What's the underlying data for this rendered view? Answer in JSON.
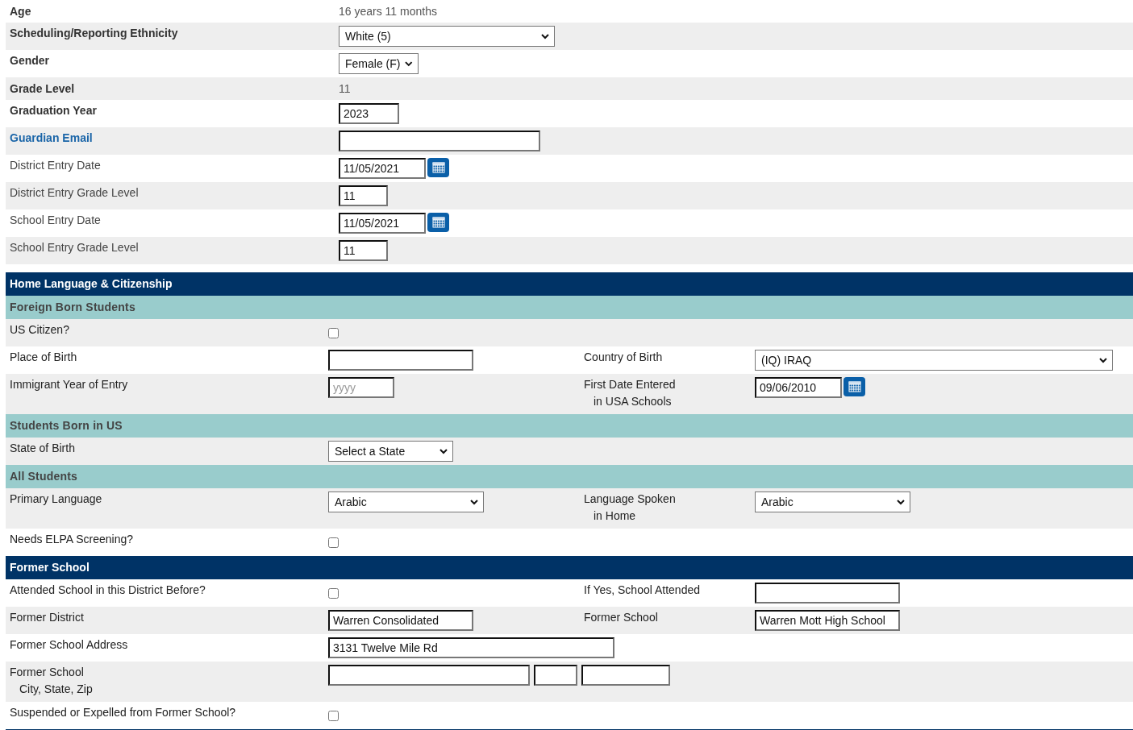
{
  "details": [
    {
      "label": "Age",
      "control": {
        "kind": "text",
        "value": "16 years 11 months"
      }
    },
    {
      "label": "Scheduling/Reporting Ethnicity",
      "control": {
        "kind": "select",
        "value": "White (5)"
      }
    },
    {
      "label": "Gender",
      "control": {
        "kind": "select",
        "value": "Female (F)"
      }
    },
    {
      "label": "Grade Level",
      "control": {
        "kind": "text",
        "value": "11"
      }
    },
    {
      "label": "Graduation Year",
      "control": {
        "kind": "input",
        "value": "2023"
      }
    },
    {
      "label": "Guardian Email",
      "control": {
        "kind": "input"
      }
    },
    {
      "label": "District Entry Date",
      "control": {
        "kind": "date",
        "value": "11/05/2021"
      }
    },
    {
      "label": "District Entry Grade Level",
      "control": {
        "kind": "input",
        "value": "11"
      }
    },
    {
      "label": "School Entry Date",
      "control": {
        "kind": "date",
        "value": "11/05/2021"
      }
    },
    {
      "label": "School Entry Grade Level",
      "control": {
        "kind": "input",
        "value": "11"
      }
    }
  ],
  "sections": [
    {
      "title": "Home Language & Citizenship",
      "groups": [
        {
          "title": "Foreign Born Students",
          "rows": [
            {
              "shaded": true,
              "label": [
                "US Citizen?"
              ],
              "control": {
                "kind": "checkbox",
                "checked": false
              }
            },
            {
              "shaded": false,
              "label": [
                "Place of Birth"
              ],
              "control": {
                "kind": "input"
              },
              "label_2": [
                "Country of Birth"
              ],
              "control_2": {
                "kind": "select",
                "value": "(IQ) IRAQ"
              }
            },
            {
              "shaded": true,
              "label": [
                "Immigrant Year of Entry"
              ],
              "control": {
                "kind": "input",
                "placeholder": "yyyy"
              },
              "label_2": [
                "First Date Entered",
                "in USA Schools"
              ],
              "control_2": {
                "kind": "date",
                "value": "09/06/2010"
              }
            }
          ]
        },
        {
          "title": "Students Born in US",
          "rows": [
            {
              "shaded": true,
              "label": [
                "State of Birth"
              ],
              "control": {
                "kind": "select",
                "value": "Select a State"
              }
            }
          ]
        },
        {
          "title": "All Students",
          "rows": [
            {
              "shaded": true,
              "label": [
                "Primary Language"
              ],
              "control": {
                "kind": "select",
                "value": "Arabic"
              },
              "label_2": [
                "Language Spoken",
                "in Home"
              ],
              "control_2": {
                "kind": "select",
                "value": "Arabic"
              }
            },
            {
              "shaded": false,
              "label": [
                "Needs ELPA Screening?"
              ],
              "control": {
                "kind": "checkbox",
                "checked": false
              }
            }
          ]
        }
      ]
    },
    {
      "title": "Former School",
      "groups": [
        {
          "rows": [
            {
              "shaded": false,
              "label": [
                "Attended School in this District Before?"
              ],
              "control": {
                "kind": "checkbox",
                "checked": false
              },
              "label_2": [
                "If Yes, School Attended"
              ],
              "control_2": {
                "kind": "input"
              }
            },
            {
              "shaded": true,
              "label": [
                "Former District"
              ],
              "control": {
                "kind": "input",
                "value": "Warren Consolidated"
              },
              "label_2": [
                "Former School"
              ],
              "control_2": {
                "kind": "input",
                "value": "Warren Mott High School"
              }
            },
            {
              "shaded": false,
              "label": [
                "Former School Address"
              ],
              "control": {
                "kind": "input",
                "value": "3131 Twelve Mile Rd"
              }
            },
            {
              "shaded": true,
              "label": [
                "Former School",
                "City, State, Zip"
              ],
              "control": {
                "kind": "inputs"
              }
            },
            {
              "shaded": false,
              "label": [
                "Suspended or Expelled from Former School?"
              ],
              "control": {
                "kind": "checkbox",
                "checked": false
              }
            }
          ]
        }
      ]
    }
  ]
}
